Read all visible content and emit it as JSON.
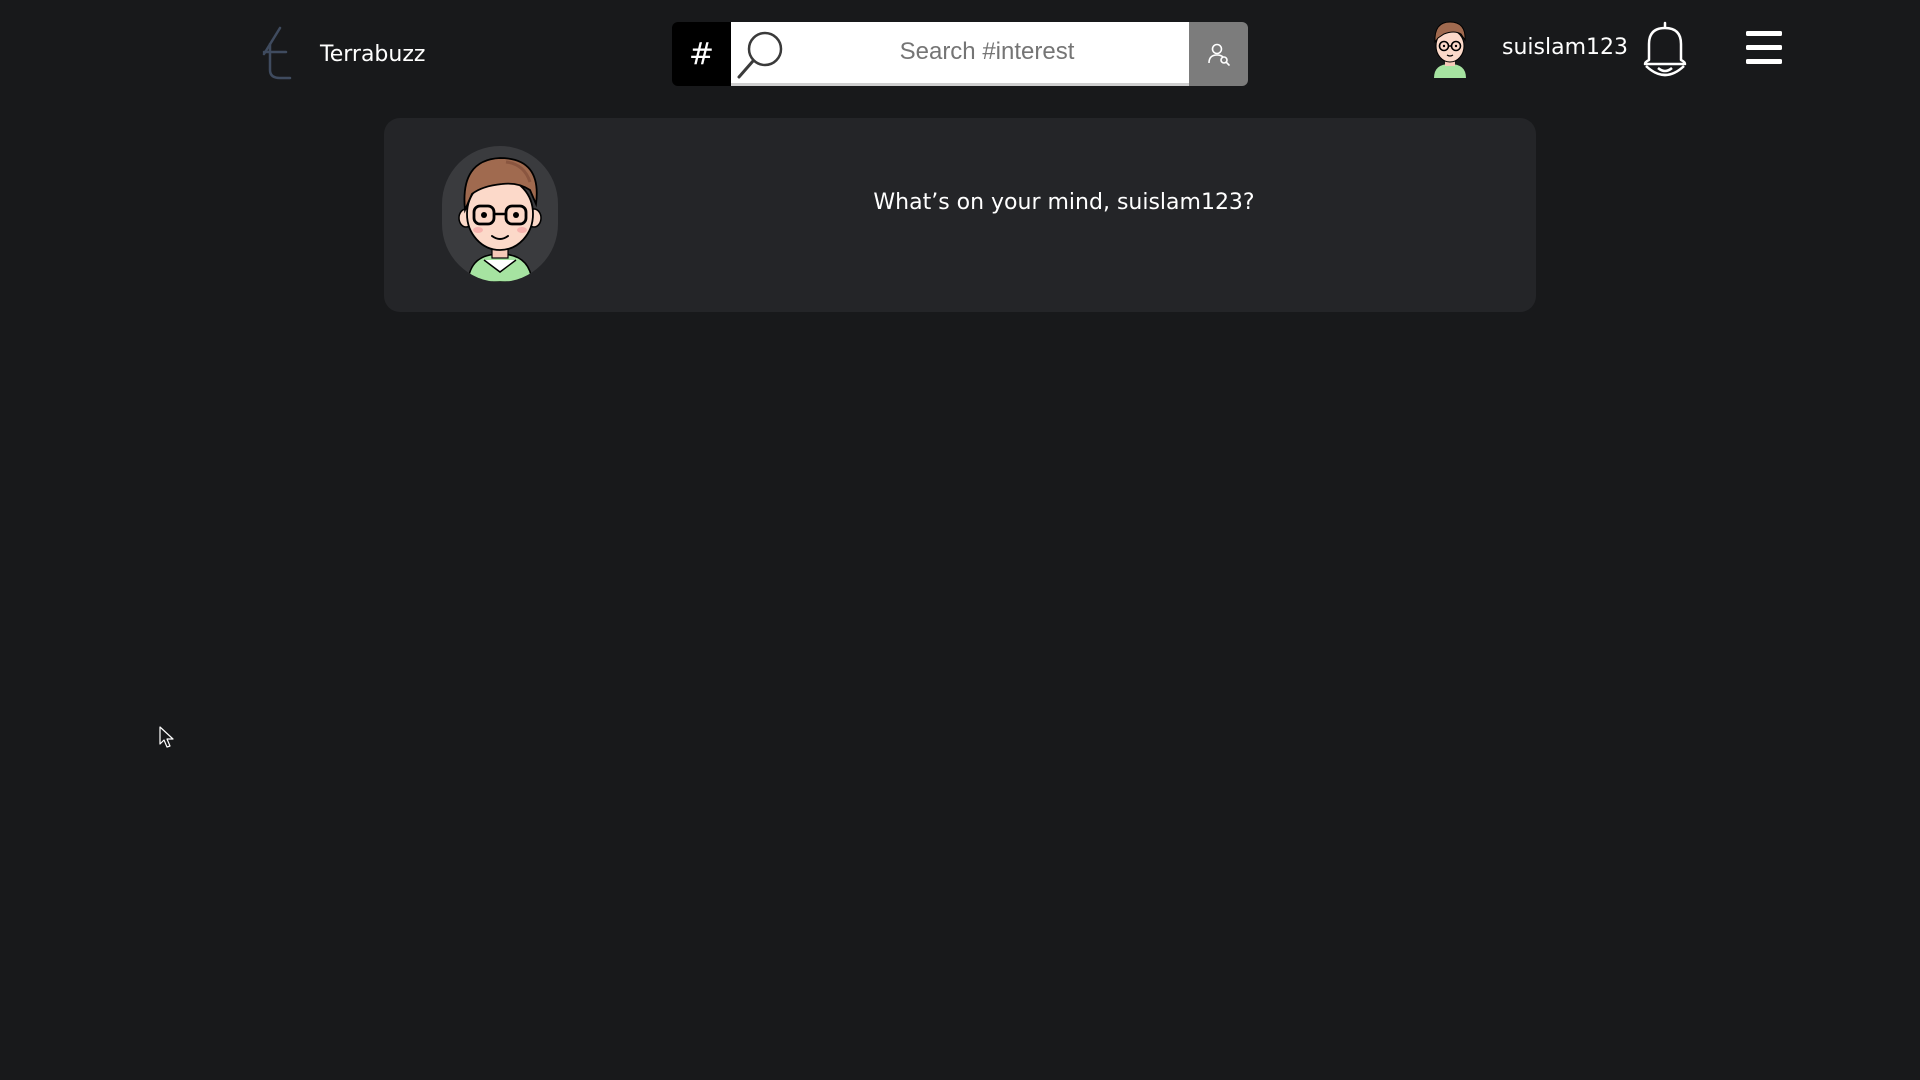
{
  "brand": {
    "name": "Terrabuzz",
    "logo_icon": "terrabuzz-t-logo-icon"
  },
  "search": {
    "prefix": "#",
    "placeholder": "Search #interest",
    "value": "",
    "search_icon": "magnifier-icon",
    "submit_icon": "user-search-icon"
  },
  "user": {
    "username": "suislam123",
    "avatar_icon": "avatar-icon"
  },
  "header_icons": {
    "bell": "bell-icon",
    "menu": "hamburger-menu-icon"
  },
  "composer": {
    "prompt": "What’s on your mind, suislam123?"
  },
  "colors": {
    "background": "#18191b",
    "card": "#242528",
    "search_submit": "#7c7c7c",
    "hash_box": "#000000",
    "logo": "#3f4b5f"
  }
}
